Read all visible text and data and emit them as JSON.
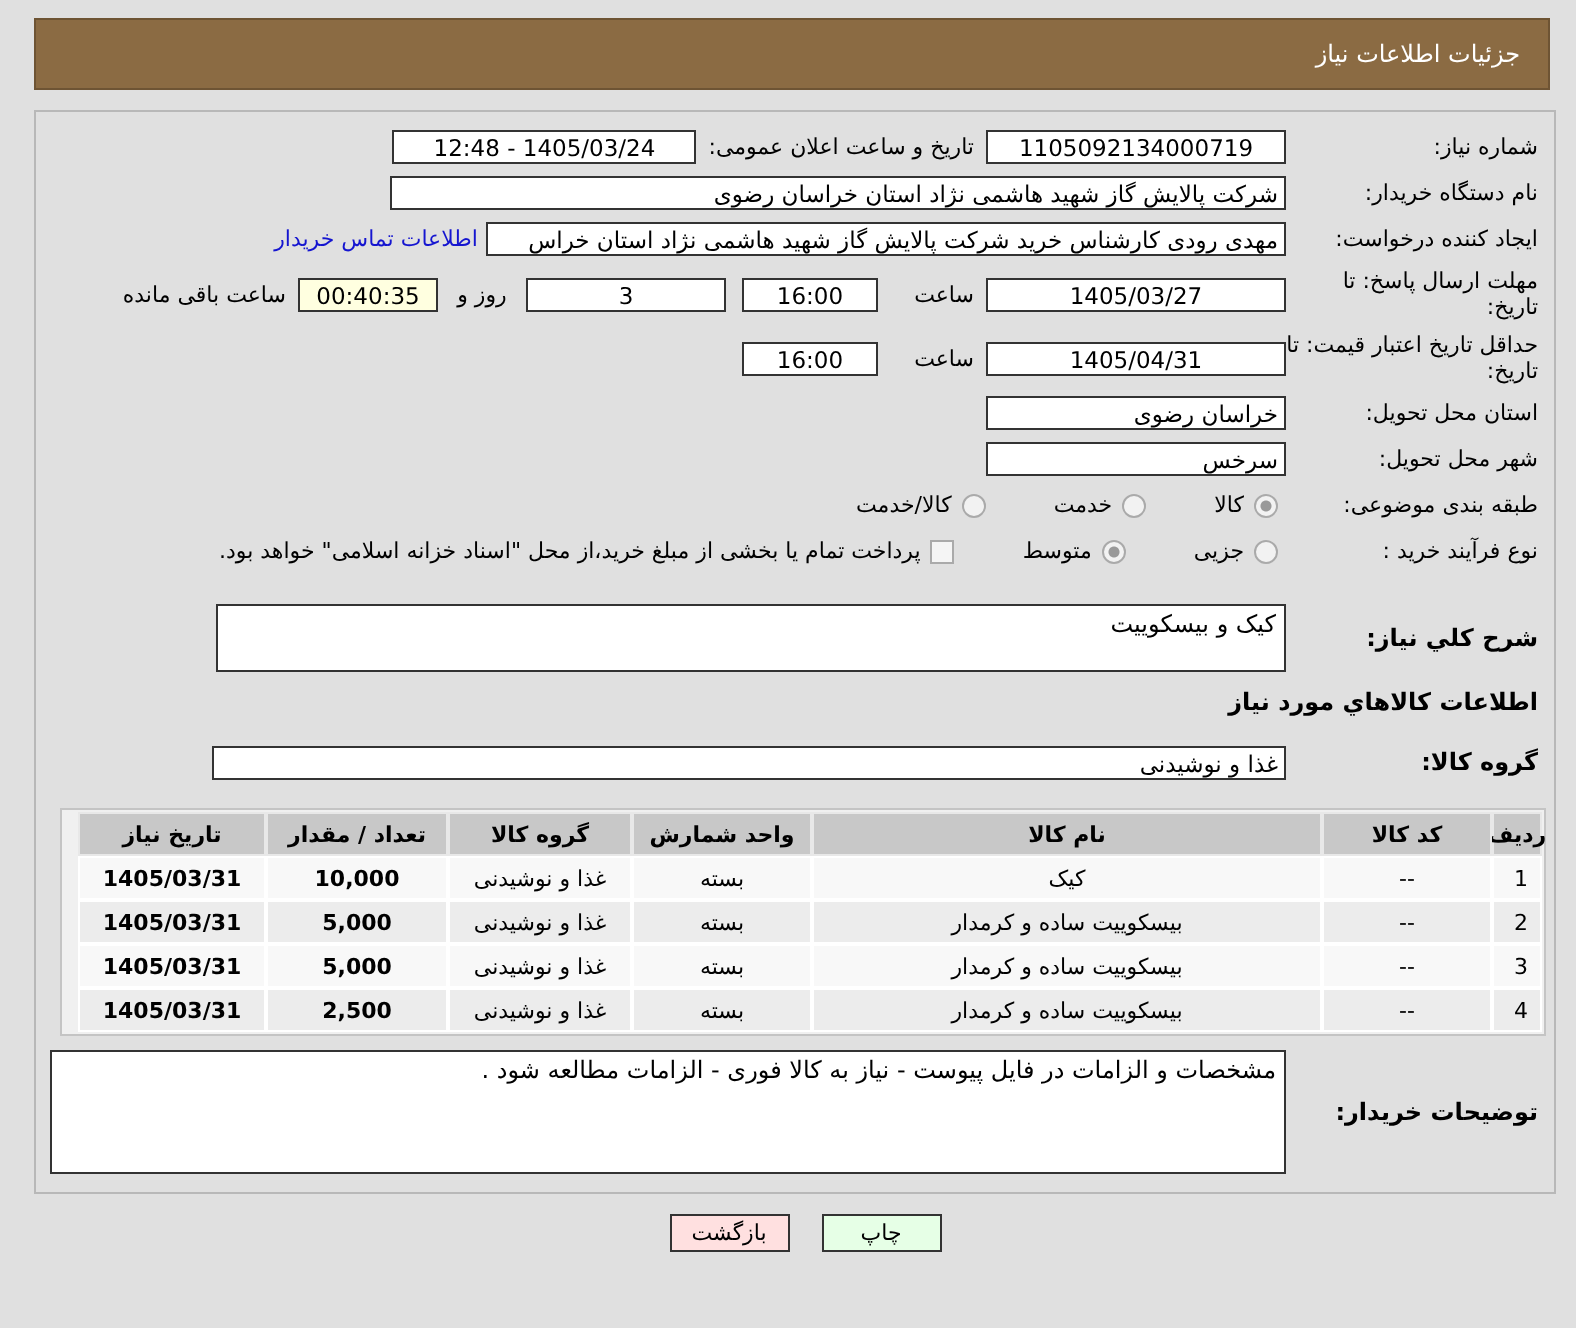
{
  "header": {
    "title": "جزئیات اطلاعات نیاز"
  },
  "need_number": {
    "label": "شماره نیاز:",
    "value": "1105092134000719"
  },
  "announce": {
    "label": "تاریخ و ساعت اعلان عمومی:",
    "value": "1405/03/24 - 12:48"
  },
  "buyer_org": {
    "label": "نام دستگاه خریدار:",
    "value": "شرکت پالایش گاز شهید هاشمی نژاد   استان خراسان رضوی"
  },
  "requester": {
    "label": "ایجاد کننده درخواست:",
    "value": "مهدی رودی کارشناس خرید شرکت پالایش گاز شهید هاشمی نژاد   استان خراس",
    "link": "اطلاعات تماس خریدار"
  },
  "deadline": {
    "label": "مهلت ارسال پاسخ: تا تاریخ:",
    "date": "1405/03/27",
    "time_label": "ساعت",
    "time": "16:00",
    "days": "3",
    "days_label": "روز و",
    "remaining": "00:40:35",
    "remaining_label": "ساعت باقی مانده"
  },
  "validity": {
    "label": "حداقل تاریخ اعتبار قیمت: تا تاریخ:",
    "date": "1405/04/31",
    "time_label": "ساعت",
    "time": "16:00"
  },
  "province": {
    "label": "استان محل تحویل:",
    "value": "خراسان رضوی"
  },
  "city": {
    "label": "شهر محل تحویل:",
    "value": "سرخس"
  },
  "category": {
    "label": "طبقه بندی موضوعی:",
    "options": [
      {
        "label": "کالا",
        "selected": true
      },
      {
        "label": "خدمت",
        "selected": false
      },
      {
        "label": "کالا/خدمت",
        "selected": false
      }
    ]
  },
  "process": {
    "label": "نوع فرآیند خرید :",
    "options": [
      {
        "label": "جزیی",
        "selected": false
      },
      {
        "label": "متوسط",
        "selected": true
      }
    ],
    "payment": {
      "checked": false,
      "text": "پرداخت تمام یا بخشی از مبلغ خرید،از محل \"اسناد خزانه اسلامی\" خواهد بود."
    }
  },
  "description": {
    "label": "شرح کلي نياز:",
    "value": "کیک و بیسکوییت"
  },
  "goods_heading": "اطلاعات کالاهاي مورد نياز",
  "goods_group": {
    "label": "گروه کالا:",
    "value": "غذا و نوشیدنی"
  },
  "table": {
    "columns": [
      "ردیف",
      "کد کالا",
      "نام کالا",
      "واحد شمارش",
      "گروه کالا",
      "تعداد / مقدار",
      "تاریخ نیاز"
    ],
    "rows": [
      [
        "1",
        "--",
        "کیک",
        "بسته",
        "غذا و نوشیدنی",
        "10,000",
        "1405/03/31"
      ],
      [
        "2",
        "--",
        "بیسکوییت ساده و کرمدار",
        "بسته",
        "غذا و نوشیدنی",
        "5,000",
        "1405/03/31"
      ],
      [
        "3",
        "--",
        "بیسکوییت ساده و کرمدار",
        "بسته",
        "غذا و نوشیدنی",
        "5,000",
        "1405/03/31"
      ],
      [
        "4",
        "--",
        "بیسکوییت ساده و کرمدار",
        "بسته",
        "غذا و نوشیدنی",
        "2,500",
        "1405/03/31"
      ]
    ]
  },
  "buyer_notes": {
    "label": "توضیحات خریدار:",
    "value": "مشخصات و الزامات در فایل پیوست -  نیاز به کالا فوری -  الزامات مطالعه شود ."
  },
  "buttons": [
    {
      "label": "چاپ",
      "kind": "print"
    },
    {
      "label": "بازگشت",
      "kind": "back"
    }
  ]
}
